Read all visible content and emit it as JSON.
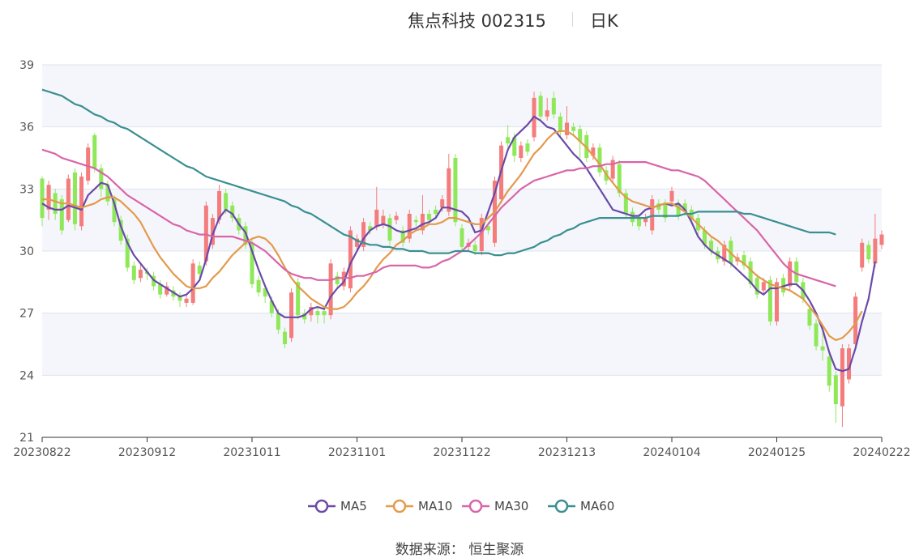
{
  "header": {
    "title": "焦点科技 002315",
    "period": "日K"
  },
  "source": {
    "label": "数据来源：",
    "name": "恒生聚源"
  },
  "colors": {
    "up": "#f47c7c",
    "down": "#8fe85a",
    "grid_band": "#f5f6fb",
    "grid_line": "#dfe3ee",
    "axis": "#333333",
    "MA5": "#6a4aa8",
    "MA10": "#e39a4c",
    "MA30": "#d865a8",
    "MA60": "#3a8f92"
  },
  "chart_data": {
    "type": "candlestick",
    "ylim": [
      21,
      39
    ],
    "yticks": [
      21,
      24,
      27,
      30,
      33,
      36,
      39
    ],
    "xticks": [
      "20230822",
      "20230912",
      "20231011",
      "20231101",
      "20231122",
      "20231213",
      "20240104",
      "20240125",
      "20240222"
    ],
    "grid": true,
    "legend_position": "bottom",
    "candles": [
      [
        33.5,
        31.6,
        33.6,
        31.2
      ],
      [
        32.0,
        33.2,
        33.4,
        31.5
      ],
      [
        32.8,
        31.8,
        33.0,
        31.5
      ],
      [
        32.5,
        31.0,
        32.7,
        30.8
      ],
      [
        31.5,
        33.5,
        33.7,
        31.4
      ],
      [
        33.8,
        31.3,
        34.0,
        31.0
      ],
      [
        31.2,
        33.6,
        33.8,
        31.0
      ],
      [
        33.4,
        35.0,
        35.2,
        33.2
      ],
      [
        35.6,
        34.0,
        35.7,
        33.8
      ],
      [
        34.0,
        33.0,
        34.2,
        32.6
      ],
      [
        33.2,
        32.4,
        33.4,
        32.2
      ],
      [
        32.5,
        31.4,
        32.7,
        31.2
      ],
      [
        31.5,
        30.5,
        31.7,
        30.3
      ],
      [
        30.6,
        29.2,
        30.8,
        29.0
      ],
      [
        29.3,
        28.6,
        29.5,
        28.4
      ],
      [
        28.7,
        29.1,
        29.4,
        28.5
      ],
      [
        29.0,
        28.9,
        29.2,
        28.6
      ],
      [
        28.8,
        28.3,
        29.0,
        28.1
      ],
      [
        28.4,
        27.9,
        28.6,
        27.7
      ],
      [
        27.9,
        28.3,
        28.5,
        27.8
      ],
      [
        28.1,
        27.8,
        28.3,
        27.6
      ],
      [
        27.8,
        27.6,
        28.0,
        27.3
      ],
      [
        27.5,
        27.7,
        27.9,
        27.3
      ],
      [
        27.5,
        29.4,
        29.6,
        27.4
      ],
      [
        29.3,
        28.9,
        29.5,
        28.7
      ],
      [
        29.5,
        32.2,
        32.4,
        29.3
      ],
      [
        30.3,
        31.6,
        31.8,
        30.1
      ],
      [
        31.5,
        32.9,
        33.2,
        31.3
      ],
      [
        32.8,
        32.0,
        33.0,
        31.8
      ],
      [
        32.2,
        31.6,
        32.4,
        31.4
      ],
      [
        31.6,
        31.0,
        31.8,
        30.8
      ],
      [
        31.2,
        30.3,
        31.4,
        30.1
      ],
      [
        30.4,
        28.4,
        30.6,
        28.2
      ],
      [
        28.6,
        28.0,
        28.8,
        27.8
      ],
      [
        28.2,
        27.8,
        28.4,
        27.5
      ],
      [
        27.6,
        27.0,
        27.8,
        26.8
      ],
      [
        27.0,
        26.2,
        27.2,
        26.0
      ],
      [
        26.1,
        25.5,
        26.3,
        25.3
      ],
      [
        25.8,
        28.0,
        28.2,
        25.6
      ],
      [
        28.5,
        26.9,
        28.7,
        26.7
      ],
      [
        27.0,
        26.7,
        27.2,
        26.5
      ],
      [
        26.9,
        27.3,
        27.5,
        26.6
      ],
      [
        27.1,
        26.9,
        27.3,
        26.5
      ],
      [
        27.1,
        26.9,
        27.3,
        26.5
      ],
      [
        26.9,
        29.4,
        29.6,
        26.7
      ],
      [
        28.8,
        28.4,
        29.0,
        28.2
      ],
      [
        28.3,
        29.0,
        29.2,
        28.1
      ],
      [
        28.2,
        31.0,
        31.2,
        28.0
      ],
      [
        30.2,
        30.6,
        30.8,
        30.0
      ],
      [
        30.2,
        31.4,
        31.6,
        30.0
      ],
      [
        31.2,
        31.0,
        31.4,
        30.8
      ],
      [
        31.2,
        32.0,
        33.1,
        31.0
      ],
      [
        31.3,
        31.7,
        32.0,
        31.1
      ],
      [
        31.6,
        30.5,
        31.8,
        30.3
      ],
      [
        31.5,
        31.7,
        31.9,
        31.3
      ],
      [
        31.0,
        30.4,
        31.2,
        30.2
      ],
      [
        30.6,
        31.8,
        32.0,
        30.4
      ],
      [
        31.5,
        31.4,
        31.7,
        31.2
      ],
      [
        31.0,
        31.8,
        32.7,
        30.8
      ],
      [
        31.8,
        31.5,
        32.0,
        31.3
      ],
      [
        32.0,
        31.8,
        32.2,
        31.6
      ],
      [
        32.1,
        32.5,
        32.7,
        31.9
      ],
      [
        31.9,
        34.0,
        34.7,
        31.7
      ],
      [
        34.5,
        31.4,
        34.7,
        31.2
      ],
      [
        31.1,
        30.2,
        31.3,
        30.0
      ],
      [
        30.2,
        30.4,
        30.6,
        30.0
      ],
      [
        30.3,
        30.0,
        30.5,
        29.8
      ],
      [
        30.0,
        31.6,
        31.8,
        29.8
      ],
      [
        31.2,
        31.0,
        31.4,
        30.8
      ],
      [
        30.4,
        33.4,
        33.6,
        30.2
      ],
      [
        32.5,
        35.1,
        35.3,
        32.3
      ],
      [
        35.5,
        35.2,
        36.1,
        35.0
      ],
      [
        35.5,
        34.6,
        35.7,
        34.3
      ],
      [
        34.5,
        35.1,
        35.3,
        34.3
      ],
      [
        35.2,
        34.8,
        35.4,
        34.6
      ],
      [
        35.5,
        37.4,
        37.7,
        35.3
      ],
      [
        37.5,
        36.5,
        37.7,
        36.3
      ],
      [
        36.5,
        36.8,
        37.4,
        36.3
      ],
      [
        37.4,
        36.6,
        37.7,
        36.4
      ],
      [
        36.5,
        35.8,
        36.7,
        35.5
      ],
      [
        35.6,
        36.2,
        37.0,
        35.4
      ],
      [
        36.0,
        35.8,
        36.2,
        35.6
      ],
      [
        35.9,
        35.3,
        36.1,
        34.5
      ],
      [
        35.6,
        34.5,
        35.8,
        34.3
      ],
      [
        34.6,
        35.0,
        35.2,
        34.4
      ],
      [
        35.0,
        33.8,
        35.2,
        33.6
      ],
      [
        33.9,
        33.4,
        34.1,
        33.2
      ],
      [
        33.5,
        34.4,
        34.6,
        33.3
      ],
      [
        34.2,
        32.8,
        34.4,
        32.6
      ],
      [
        32.8,
        31.8,
        33.0,
        31.6
      ],
      [
        31.9,
        31.4,
        32.1,
        31.2
      ],
      [
        31.6,
        31.2,
        31.8,
        31.0
      ],
      [
        31.4,
        31.6,
        31.8,
        31.2
      ],
      [
        31.0,
        32.5,
        32.7,
        30.8
      ],
      [
        32.3,
        32.0,
        32.5,
        31.8
      ],
      [
        32.3,
        31.6,
        32.5,
        31.4
      ],
      [
        32.4,
        32.9,
        33.1,
        32.2
      ],
      [
        32.3,
        31.7,
        32.5,
        31.5
      ],
      [
        32.3,
        31.9,
        32.5,
        31.7
      ],
      [
        32.0,
        31.5,
        32.2,
        31.3
      ],
      [
        31.6,
        31.0,
        31.8,
        30.8
      ],
      [
        31.0,
        30.3,
        31.2,
        30.1
      ],
      [
        30.5,
        30.0,
        30.7,
        29.8
      ],
      [
        30.0,
        29.6,
        30.2,
        29.4
      ],
      [
        29.5,
        30.3,
        30.5,
        29.3
      ],
      [
        30.5,
        29.4,
        30.7,
        29.2
      ],
      [
        29.5,
        29.7,
        29.9,
        29.3
      ],
      [
        29.8,
        29.3,
        30.0,
        29.1
      ],
      [
        29.5,
        28.4,
        29.7,
        28.2
      ],
      [
        28.7,
        27.9,
        28.9,
        27.7
      ],
      [
        28.1,
        28.5,
        28.7,
        27.9
      ],
      [
        28.6,
        26.6,
        28.8,
        26.4
      ],
      [
        26.6,
        28.5,
        28.7,
        26.4
      ],
      [
        28.7,
        28.0,
        28.9,
        27.8
      ],
      [
        28.3,
        29.5,
        29.7,
        28.1
      ],
      [
        29.5,
        28.5,
        29.7,
        28.3
      ],
      [
        28.5,
        27.7,
        28.7,
        27.5
      ],
      [
        27.2,
        26.4,
        27.4,
        26.2
      ],
      [
        26.5,
        25.4,
        26.7,
        25.2
      ],
      [
        25.4,
        25.2,
        26.4,
        24.7
      ],
      [
        24.9,
        23.5,
        25.1,
        23.2
      ],
      [
        24.0,
        22.6,
        24.2,
        21.7
      ],
      [
        22.5,
        25.3,
        25.5,
        21.5
      ],
      [
        23.8,
        25.3,
        25.5,
        23.6
      ],
      [
        25.5,
        27.8,
        28.0,
        25.3
      ],
      [
        29.2,
        30.4,
        30.6,
        29.0
      ],
      [
        30.3,
        29.6,
        30.5,
        29.4
      ],
      [
        29.4,
        30.6,
        31.8,
        29.2
      ],
      [
        30.3,
        30.8,
        31.0,
        30.1
      ]
    ],
    "series": [
      {
        "name": "MA5",
        "values": [
          32.3,
          32.1,
          32.0,
          32.0,
          32.2,
          32.1,
          32.0,
          32.7,
          33.0,
          33.3,
          33.2,
          32.3,
          31.2,
          30.4,
          29.8,
          29.4,
          29.0,
          28.6,
          28.4,
          28.2,
          28.0,
          27.8,
          27.9,
          28.2,
          28.6,
          29.6,
          30.8,
          31.6,
          32.0,
          31.8,
          31.3,
          30.9,
          30.0,
          29.1,
          28.3,
          27.6,
          27.0,
          26.8,
          26.8,
          26.8,
          26.9,
          27.2,
          27.3,
          27.2,
          27.8,
          28.2,
          28.5,
          29.4,
          30.0,
          30.6,
          31.0,
          31.2,
          31.3,
          31.2,
          31.0,
          30.9,
          31.0,
          31.1,
          31.3,
          31.4,
          31.6,
          32.1,
          32.1,
          32.0,
          31.9,
          31.6,
          30.9,
          31.0,
          31.9,
          32.8,
          33.9,
          34.9,
          35.5,
          35.8,
          36.1,
          36.5,
          36.3,
          36.0,
          35.9,
          35.5,
          35.1,
          34.7,
          34.4,
          34.0,
          33.5,
          33.0,
          32.5,
          32.0,
          31.9,
          31.8,
          31.7,
          31.7,
          32.0,
          32.1,
          32.2,
          32.3,
          32.2,
          32.3,
          32.0,
          31.4,
          30.7,
          30.3,
          30.0,
          29.8,
          29.6,
          29.4,
          29.1,
          28.8,
          28.5,
          28.1,
          27.9,
          28.2,
          28.2,
          28.3,
          28.4,
          28.4,
          28.1,
          27.6,
          27.0,
          26.2,
          25.1,
          24.3,
          24.2,
          24.3,
          25.3,
          26.6,
          27.7,
          29.5
        ]
      },
      {
        "name": "MA10",
        "values": [
          32.5,
          32.5,
          32.4,
          32.3,
          32.3,
          32.2,
          32.1,
          32.2,
          32.3,
          32.5,
          32.6,
          32.6,
          32.4,
          32.1,
          31.8,
          31.4,
          30.8,
          30.2,
          29.7,
          29.3,
          28.9,
          28.6,
          28.3,
          28.2,
          28.2,
          28.3,
          28.7,
          29.0,
          29.4,
          29.8,
          30.1,
          30.4,
          30.6,
          30.7,
          30.6,
          30.3,
          29.8,
          29.2,
          28.7,
          28.3,
          28.0,
          27.7,
          27.5,
          27.3,
          27.2,
          27.2,
          27.3,
          27.6,
          28.0,
          28.3,
          28.7,
          29.2,
          29.6,
          29.9,
          30.3,
          30.5,
          30.8,
          31.0,
          31.1,
          31.3,
          31.3,
          31.4,
          31.6,
          31.6,
          31.5,
          31.4,
          31.3,
          31.3,
          31.6,
          31.9,
          32.4,
          32.9,
          33.3,
          33.7,
          34.2,
          34.7,
          35.0,
          35.4,
          35.7,
          35.8,
          35.8,
          35.6,
          35.3,
          35.0,
          34.6,
          34.2,
          33.7,
          33.3,
          32.9,
          32.6,
          32.4,
          32.3,
          32.2,
          32.1,
          32.2,
          32.3,
          32.3,
          32.1,
          31.9,
          31.6,
          31.3,
          31.0,
          30.7,
          30.5,
          30.2,
          29.9,
          29.6,
          29.4,
          29.1,
          28.8,
          28.6,
          28.4,
          28.3,
          28.2,
          28.1,
          27.9,
          27.7,
          27.3,
          26.9,
          26.4,
          25.9,
          25.7,
          25.8,
          26.1,
          26.5,
          27.1
        ]
      },
      {
        "name": "MA30",
        "values": [
          34.9,
          34.8,
          34.7,
          34.5,
          34.4,
          34.3,
          34.2,
          34.1,
          34.0,
          33.8,
          33.6,
          33.3,
          33.0,
          32.7,
          32.5,
          32.3,
          32.1,
          31.9,
          31.7,
          31.5,
          31.3,
          31.2,
          31.0,
          30.9,
          30.8,
          30.8,
          30.7,
          30.7,
          30.7,
          30.7,
          30.6,
          30.5,
          30.4,
          30.2,
          30.0,
          29.7,
          29.4,
          29.1,
          28.9,
          28.8,
          28.7,
          28.7,
          28.6,
          28.6,
          28.6,
          28.7,
          28.7,
          28.7,
          28.8,
          28.8,
          28.9,
          29.0,
          29.2,
          29.3,
          29.3,
          29.3,
          29.3,
          29.3,
          29.2,
          29.2,
          29.3,
          29.5,
          29.6,
          29.8,
          30.0,
          30.3,
          30.6,
          30.9,
          31.3,
          31.7,
          32.1,
          32.4,
          32.7,
          33.0,
          33.2,
          33.4,
          33.5,
          33.6,
          33.7,
          33.8,
          33.9,
          33.9,
          34.0,
          34.0,
          34.1,
          34.1,
          34.2,
          34.2,
          34.3,
          34.3,
          34.3,
          34.3,
          34.3,
          34.2,
          34.1,
          34.0,
          33.9,
          33.9,
          33.8,
          33.7,
          33.6,
          33.4,
          33.1,
          32.8,
          32.5,
          32.2,
          31.9,
          31.6,
          31.3,
          31.0,
          30.6,
          30.2,
          29.8,
          29.4,
          29.1,
          28.9,
          28.8,
          28.7,
          28.6,
          28.5,
          28.4,
          28.3
        ]
      },
      {
        "name": "MA60",
        "values": [
          37.8,
          37.7,
          37.6,
          37.5,
          37.3,
          37.1,
          37.0,
          36.8,
          36.6,
          36.5,
          36.3,
          36.2,
          36.0,
          35.9,
          35.7,
          35.5,
          35.3,
          35.1,
          34.9,
          34.7,
          34.5,
          34.3,
          34.1,
          34.0,
          33.8,
          33.6,
          33.5,
          33.4,
          33.3,
          33.2,
          33.1,
          33.0,
          32.9,
          32.8,
          32.7,
          32.6,
          32.5,
          32.4,
          32.2,
          32.1,
          31.9,
          31.8,
          31.6,
          31.4,
          31.2,
          31.0,
          30.8,
          30.7,
          30.5,
          30.4,
          30.3,
          30.3,
          30.2,
          30.2,
          30.1,
          30.1,
          30.0,
          30.0,
          30.0,
          29.9,
          29.9,
          29.9,
          29.9,
          30.0,
          30.0,
          30.0,
          29.9,
          29.9,
          29.9,
          29.8,
          29.8,
          29.9,
          29.9,
          30.0,
          30.1,
          30.2,
          30.4,
          30.5,
          30.7,
          30.8,
          31.0,
          31.1,
          31.3,
          31.4,
          31.5,
          31.6,
          31.6,
          31.6,
          31.6,
          31.6,
          31.6,
          31.6,
          31.6,
          31.7,
          31.7,
          31.7,
          31.7,
          31.7,
          31.8,
          31.8,
          31.9,
          31.9,
          31.9,
          31.9,
          31.9,
          31.9,
          31.9,
          31.8,
          31.8,
          31.7,
          31.6,
          31.5,
          31.4,
          31.3,
          31.2,
          31.1,
          31.0,
          30.9,
          30.9,
          30.9,
          30.9,
          30.8
        ]
      }
    ]
  }
}
